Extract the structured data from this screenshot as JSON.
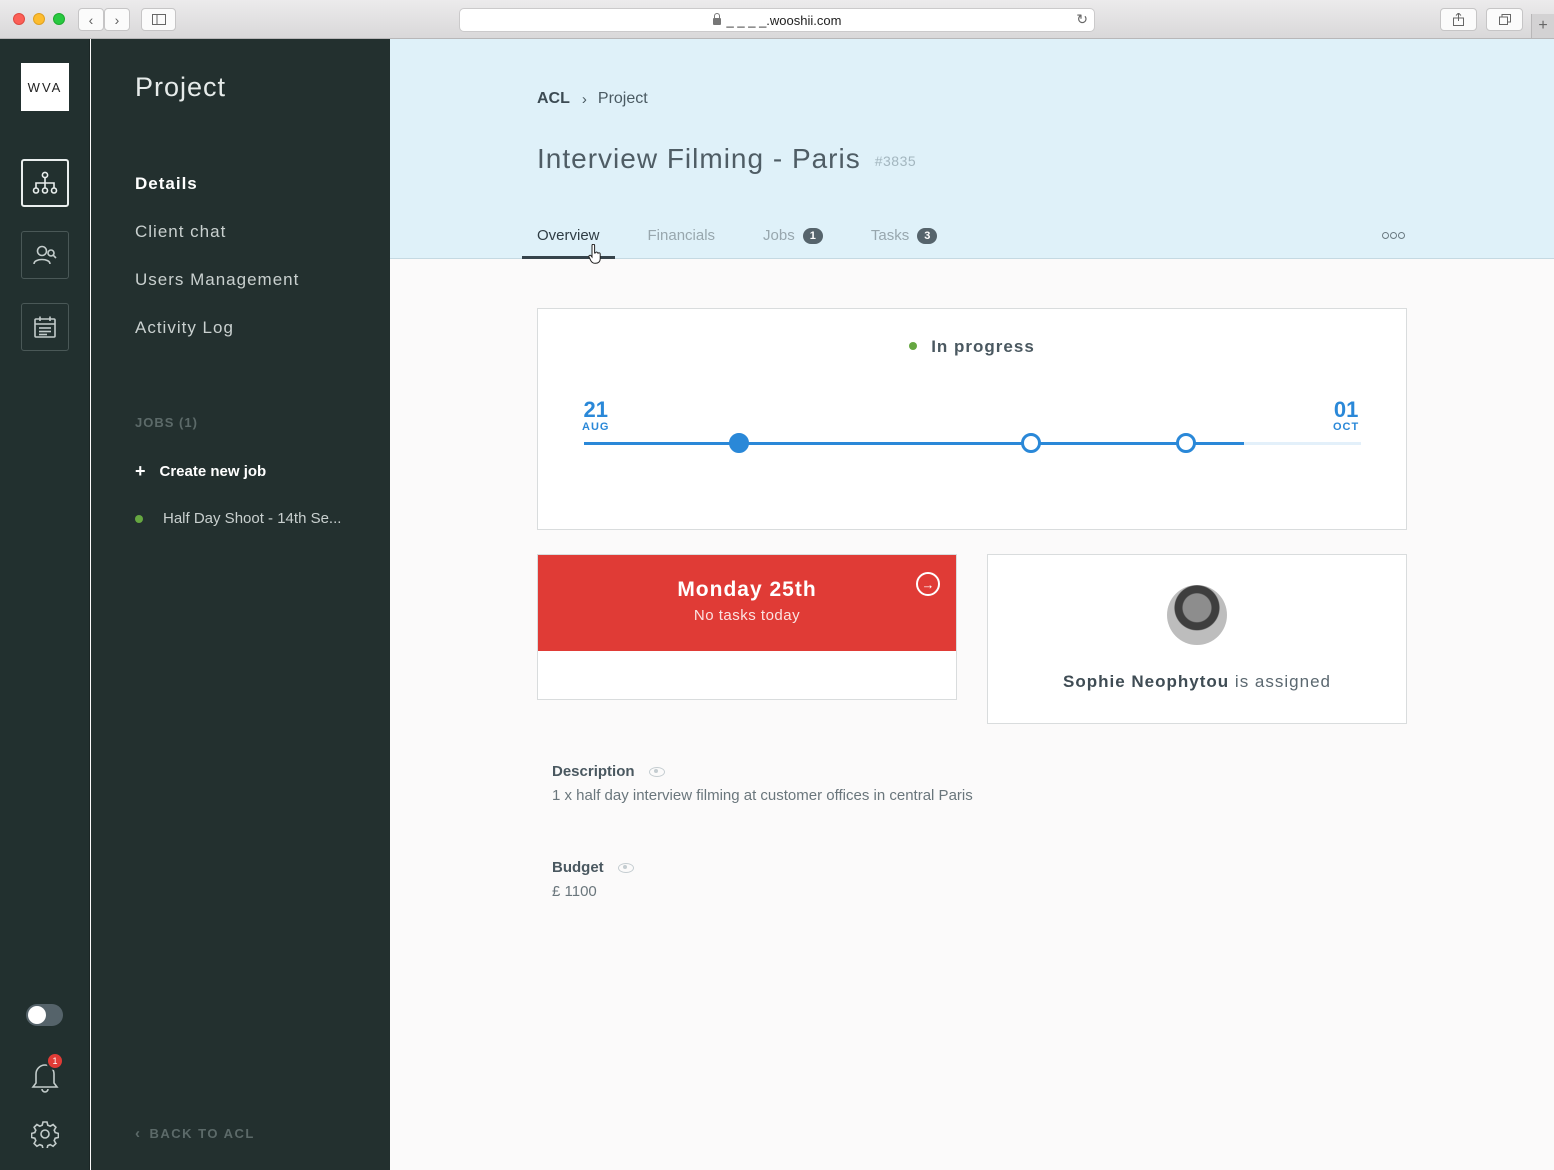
{
  "browser": {
    "url": "_ _ _ _.wooshii.com"
  },
  "rail": {
    "logo": "WVA",
    "notification_count": "1"
  },
  "nav": {
    "title": "Project",
    "items": [
      {
        "label": "Details",
        "active": true
      },
      {
        "label": "Client chat",
        "active": false
      },
      {
        "label": "Users Management",
        "active": false
      },
      {
        "label": "Activity Log",
        "active": false
      }
    ],
    "jobs_heading": "JOBS (1)",
    "create_job": "Create new job",
    "jobs": [
      {
        "label": "Half Day Shoot - 14th Se...",
        "status_color": "#66a741"
      }
    ],
    "back_link": "BACK TO ACL"
  },
  "header": {
    "breadcrumb": {
      "root": "ACL",
      "current": "Project"
    },
    "title": "Interview Filming - Paris",
    "project_id": "#3835",
    "tabs": [
      {
        "label": "Overview",
        "count": "",
        "active": true
      },
      {
        "label": "Financials",
        "count": "",
        "active": false
      },
      {
        "label": "Jobs",
        "count": "1",
        "active": false
      },
      {
        "label": "Tasks",
        "count": "3",
        "active": false
      }
    ]
  },
  "status": {
    "label": "In progress",
    "color": "#66a741",
    "start": {
      "day": "21",
      "month": "AUG"
    },
    "end": {
      "day": "01",
      "month": "OCT"
    },
    "progress_fraction": 0.85,
    "milestone_fractions": [
      0.2,
      0.575,
      0.775
    ],
    "accent": "#2a88d8"
  },
  "today": {
    "day": "Monday 25th",
    "subtitle": "No tasks today",
    "color": "#e03b36"
  },
  "assignee": {
    "name": "Sophie Neophytou",
    "suffix": "is assigned"
  },
  "details": {
    "description_label": "Description",
    "description": "1 x half day interview filming at customer offices in central Paris",
    "budget_label": "Budget",
    "budget": "£ 1100"
  }
}
